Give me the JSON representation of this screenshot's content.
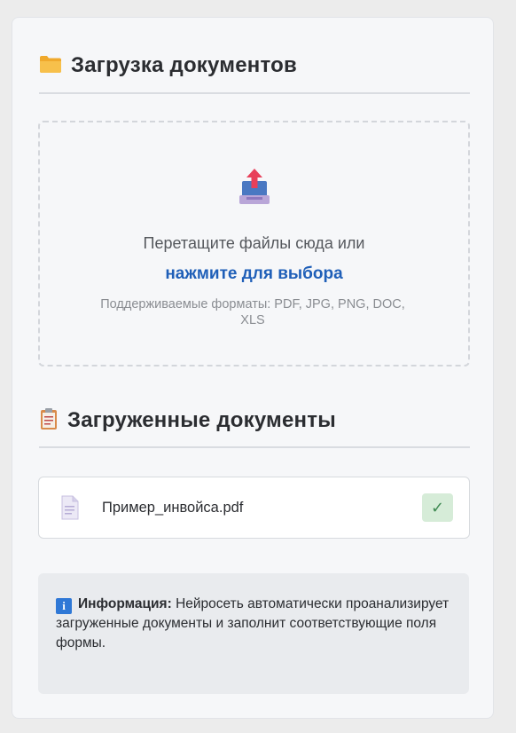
{
  "upload_section": {
    "icon": "folder-icon",
    "title": "Загрузка документов"
  },
  "dropzone": {
    "icon": "upload-tray-icon",
    "main_text": "Перетащите файлы сюда или",
    "link_text": "нажмите для выбора",
    "formats_text": "Поддерживаемые форматы: PDF, JPG, PNG, DOC, XLS"
  },
  "uploaded_section": {
    "icon": "clipboard-icon",
    "title": "Загруженные документы"
  },
  "files": [
    {
      "icon": "document-icon",
      "name": "Пример_инвойса.pdf",
      "status_icon": "checkmark-icon",
      "status_glyph": "✓"
    }
  ],
  "info": {
    "icon": "info-icon",
    "icon_glyph": "i",
    "label": "Информация:",
    "text": "Нейросеть автоматически проанализирует загруженные документы и заполнит соответствующие поля формы."
  },
  "colors": {
    "accent_link": "#1f5fb8",
    "success_bg": "#d6ecd8",
    "info_icon": "#2f78d6"
  }
}
